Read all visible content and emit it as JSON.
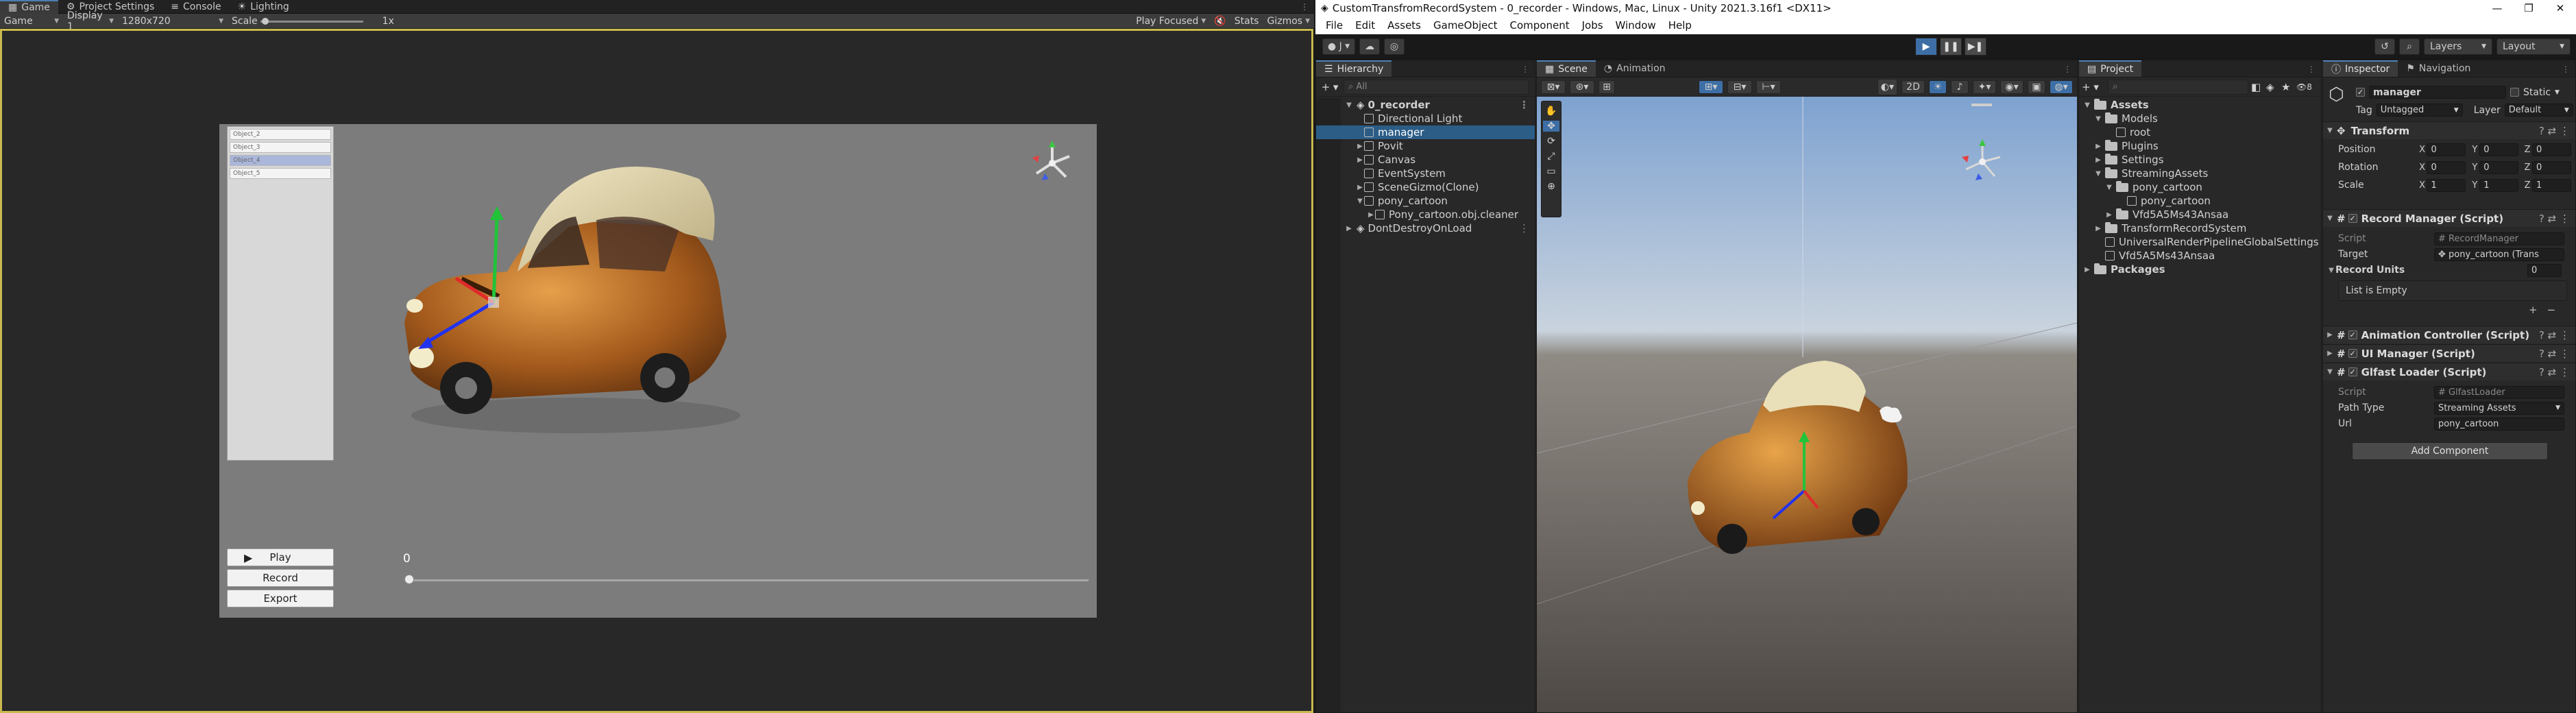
{
  "game": {
    "tabs": [
      {
        "label": "Game",
        "icon": "gamepad-icon"
      },
      {
        "label": "Project Settings",
        "icon": "gear-icon"
      },
      {
        "label": "Console",
        "icon": "console-icon"
      },
      {
        "label": "Lighting",
        "icon": "light-icon"
      }
    ],
    "toolbar": {
      "mode": "Game",
      "display": "Display 1",
      "resolution": "1280x720",
      "scale_label": "Scale",
      "scale_value": "1x",
      "play_focused": "Play Focused",
      "stats": "Stats",
      "gizmos": "Gizmos"
    },
    "object_list": [
      "Object_2",
      "Object_3",
      "Object_4",
      "Object_5"
    ],
    "selected_object_index": 2,
    "buttons": {
      "play": "Play",
      "record": "Record",
      "export": "Export"
    },
    "timeline": {
      "value": "0",
      "progress": 0
    }
  },
  "editor": {
    "title": "CustomTransfromRecordSystem - 0_recorder - Windows, Mac, Linux - Unity 2021.3.16f1 <DX11>",
    "menu": [
      "File",
      "Edit",
      "Assets",
      "GameObject",
      "Component",
      "Jobs",
      "Window",
      "Help"
    ],
    "toolbar": {
      "account": "J",
      "layers": "Layers",
      "layout": "Layout"
    },
    "hierarchy": {
      "tab": "Hierarchy",
      "search_placeholder": "All",
      "scene": "0_recorder",
      "items": [
        {
          "label": "Directional Light",
          "depth": 1,
          "expandable": false
        },
        {
          "label": "manager",
          "depth": 1,
          "expandable": false,
          "selected": true
        },
        {
          "label": "Povit",
          "depth": 1,
          "expandable": true
        },
        {
          "label": "Canvas",
          "depth": 1,
          "expandable": true
        },
        {
          "label": "EventSystem",
          "depth": 1,
          "expandable": false
        },
        {
          "label": "SceneGizmo(Clone)",
          "depth": 1,
          "expandable": true
        },
        {
          "label": "pony_cartoon",
          "depth": 1,
          "expandable": true,
          "expanded": true
        },
        {
          "label": "Pony_cartoon.obj.cleaner",
          "depth": 2,
          "expandable": true
        }
      ],
      "dont_destroy": "DontDestroyOnLoad"
    },
    "scene_view": {
      "tabs": [
        "Scene",
        "Animation"
      ],
      "mode_2d": "2D"
    },
    "project": {
      "tab": "Project",
      "root": "Assets",
      "items": [
        {
          "label": "Models",
          "depth": 1,
          "type": "folder",
          "expanded": true
        },
        {
          "label": "root",
          "depth": 2,
          "type": "asset"
        },
        {
          "label": "Plugins",
          "depth": 1,
          "type": "folder"
        },
        {
          "label": "Settings",
          "depth": 1,
          "type": "folder"
        },
        {
          "label": "StreamingAssets",
          "depth": 1,
          "type": "folder",
          "expanded": true
        },
        {
          "label": "pony_cartoon",
          "depth": 2,
          "type": "folder",
          "expanded": true
        },
        {
          "label": "pony_cartoon",
          "depth": 3,
          "type": "asset"
        },
        {
          "label": "Vfd5A5Ms43Ansaa",
          "depth": 2,
          "type": "folder"
        },
        {
          "label": "TransformRecordSystem",
          "depth": 1,
          "type": "folder"
        },
        {
          "label": "UniversalRenderPipelineGlobalSettings",
          "depth": 1,
          "type": "asset"
        },
        {
          "label": "Vfd5A5Ms43Ansaa",
          "depth": 1,
          "type": "asset"
        }
      ],
      "packages": "Packages",
      "count": "8"
    },
    "inspector": {
      "tabs": [
        "Inspector",
        "Navigation"
      ],
      "object_name": "manager",
      "static_label": "Static",
      "tag_label": "Tag",
      "tag_value": "Untagged",
      "layer_label": "Layer",
      "layer_value": "Default",
      "transform": {
        "title": "Transform",
        "rows": [
          {
            "label": "Position",
            "x": "0",
            "y": "0",
            "z": "0"
          },
          {
            "label": "Rotation",
            "x": "0",
            "y": "0",
            "z": "0"
          },
          {
            "label": "Scale",
            "x": "1",
            "y": "1",
            "z": "1"
          }
        ]
      },
      "record_manager": {
        "title": "Record Manager (Script)",
        "script_label": "Script",
        "script_value": "RecordManager",
        "target_label": "Target",
        "target_value": "pony_cartoon (Trans",
        "record_units_label": "Record Units",
        "record_units_count": "0",
        "list_empty": "List is Empty"
      },
      "animation_controller": {
        "title": "Animation Controller (Script)"
      },
      "ui_manager": {
        "title": "UI Manager (Script)"
      },
      "gltf_loader": {
        "title": "Glfast Loader (Script)",
        "script_label": "Script",
        "script_value": "GlfastLoader",
        "path_type_label": "Path Type",
        "path_type_value": "Streaming Assets",
        "url_label": "Url",
        "url_value": "pony_cartoon"
      },
      "add_component": "Add Component"
    }
  }
}
